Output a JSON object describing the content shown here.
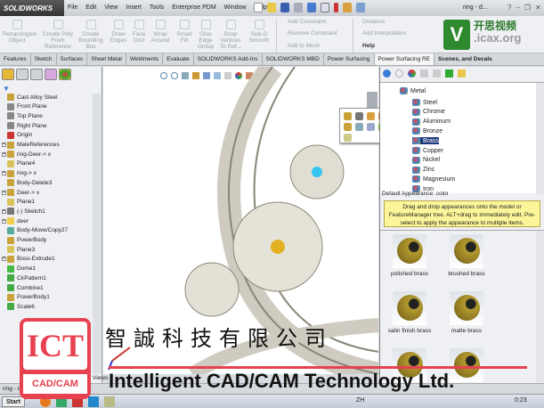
{
  "app": {
    "logo": "SOLIDWORKS",
    "document": "ring - d...",
    "menu": [
      "File",
      "Edit",
      "View",
      "Insert",
      "Tools",
      "Enterprise PDM",
      "Window",
      "Help"
    ]
  },
  "ribbon": {
    "buttons": [
      "Retopologize Object",
      "Create Poly From Reference",
      "Create Bounding Box",
      "Draw Edges",
      "Face Grid",
      "Wrap Around",
      "Smart Fill",
      "Glue Edge Group",
      "Snap Vertices To Ref...",
      "Sub-D Smooth"
    ],
    "stack1": [
      "Add Constraint",
      "Remove Constraint",
      "Add to Mesh"
    ],
    "stack2": [
      "Distance",
      "Add Interpolation",
      "Help"
    ]
  },
  "watermark": {
    "letter": "V",
    "cn": "开思视频",
    "site": ".icax.org"
  },
  "tabs": [
    "Features",
    "Sketch",
    "Surfaces",
    "Sheet Metal",
    "Weldments",
    "Evaluate",
    "SOLIDWORKS Add-Ins",
    "SOLIDWORKS MBD",
    "Power Surfacing",
    "Power Surfacing RE",
    "Scenes, and Decals"
  ],
  "active_tab": "Power Surfacing RE",
  "tree": [
    "Cast Alloy Steel",
    "Front Plane",
    "Top Plane",
    "Right Plane",
    "Origin",
    "MateReferences",
    "ring-Deer-> x",
    "Plane4",
    "ring-> x",
    "Body-Delete3",
    "Deer-> x",
    "Plane1",
    "(-) Sketch1",
    "deer",
    "Body-Move/Copy27",
    "PowerBody",
    "Plane3",
    "Boss-Extrude1",
    "Dome1",
    "CirPattern1",
    "Combine1",
    "PowerBody1",
    "Scale6"
  ],
  "tree_expandable": [
    5,
    6,
    8,
    10,
    12,
    13,
    17
  ],
  "appearances": {
    "folder": "Metal",
    "items": [
      "Steel",
      "Chrome",
      "Aluminum",
      "Bronze",
      "Brass",
      "Copper",
      "Nickel",
      "Zinc",
      "Magnesium",
      "Iron"
    ],
    "default_label": "Default Appearance: color",
    "tip": "Drag and drop appearances onto the model or FeatureManager tree.  ALT+drag to immediately edit. Pre-select to apply the appearance to multiple items.",
    "swatches": [
      "polished brass",
      "brushed brass",
      "satin finish brass",
      "matte brass",
      "",
      ""
    ]
  },
  "status": {
    "left": "ring - de",
    "views": "Views"
  },
  "taskbar": {
    "start": "Start",
    "lang": "ZH",
    "clock": "0:23"
  },
  "overlay": {
    "logo_top": "ICT",
    "logo_bottom": "CAD/CAM",
    "cn": "智誠科技有限公司",
    "en": "Intelligent CAD/CAM Technology Ltd."
  }
}
